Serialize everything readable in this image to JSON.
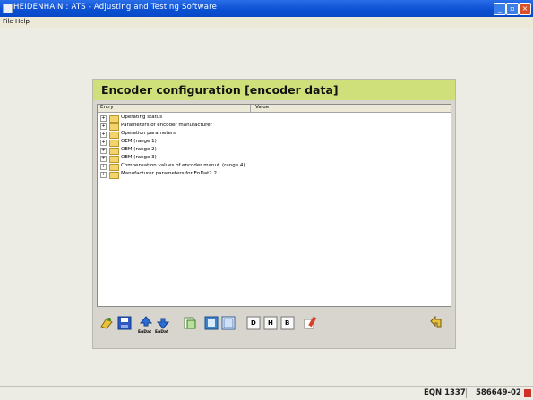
{
  "window": {
    "title": "HEIDENHAIN : ATS - Adjusting and Testing Software",
    "menu": [
      "File",
      "Help"
    ]
  },
  "panel": {
    "title": "Encoder configuration [encoder data]",
    "columns": [
      "Entry",
      "Value"
    ],
    "items": [
      "Operating status",
      "Parameters of encoder manufacturer",
      "Operation parameters",
      "OEM (range 1)",
      "OEM (range 2)",
      "OEM (range 3)",
      "Compensation values of encoder manuf. (range 4)",
      "Manufacturer parameters for EnDat2.2"
    ]
  },
  "toolbar": {
    "buttons": [
      {
        "name": "open-icon",
        "label": ""
      },
      {
        "name": "save-icon",
        "label": ""
      },
      {
        "name": "endat-upload-icon",
        "label": "EnDat"
      },
      {
        "name": "endat-download-icon",
        "label": "EnDat"
      },
      {
        "name": "copy-icon",
        "label": ""
      },
      {
        "name": "view-icon",
        "label": ""
      },
      {
        "name": "list-icon",
        "label": ""
      },
      {
        "name": "display-d-icon",
        "label": "D"
      },
      {
        "name": "display-h-icon",
        "label": "H"
      },
      {
        "name": "display-b-icon",
        "label": "B"
      },
      {
        "name": "edit-icon",
        "label": ""
      },
      {
        "name": "back-icon",
        "label": ""
      }
    ]
  },
  "status": {
    "encoder": "EQN 1337",
    "id": "586649-02"
  }
}
